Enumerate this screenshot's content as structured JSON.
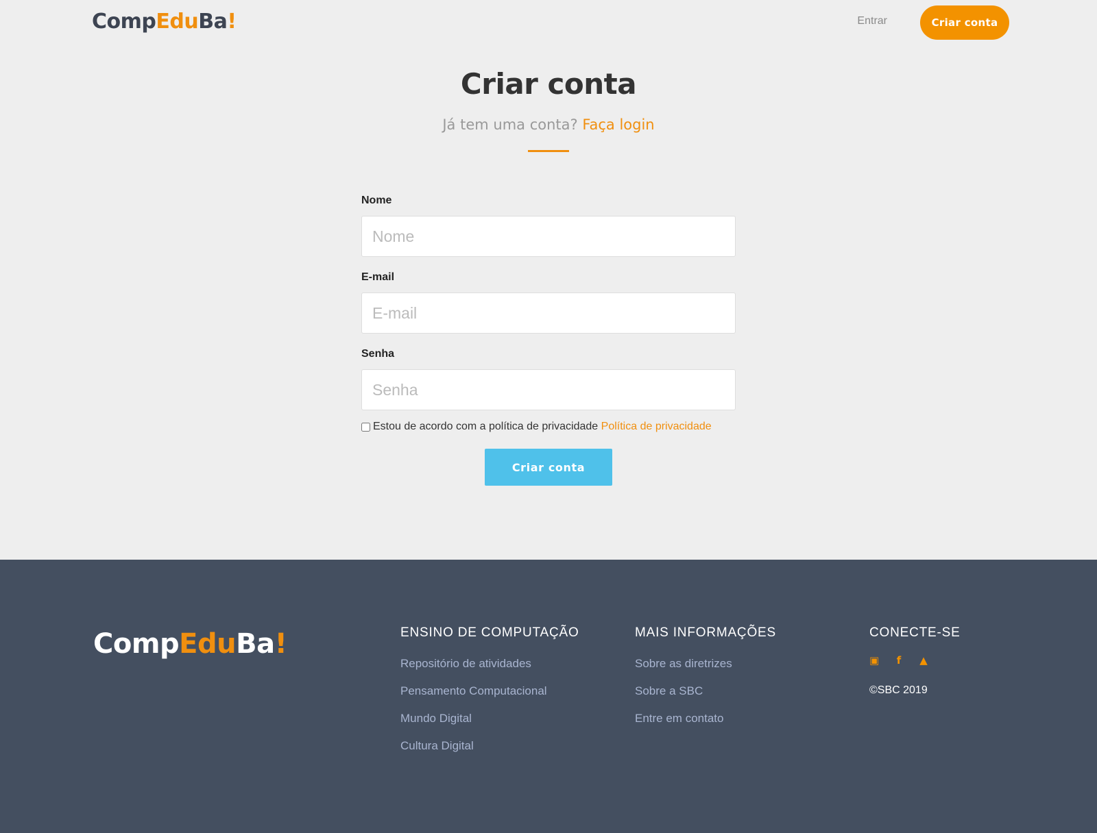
{
  "header": {
    "logo": {
      "part1": "Comp",
      "part2": "Edu",
      "part3": "Ba",
      "part4": "!"
    },
    "login_label": "Entrar",
    "signup_label": "Criar conta"
  },
  "main": {
    "title": "Criar conta",
    "subtitle_text": "Já tem uma conta?",
    "subtitle_link": "Faça login",
    "form": {
      "name_label": "Nome",
      "name_placeholder": "Nome",
      "email_label": "E-mail",
      "email_placeholder": "E-mail",
      "password_label": "Senha",
      "password_placeholder": "Senha",
      "privacy_text": "Estou de acordo com a política de privacidade",
      "privacy_link": "Política de privacidade",
      "submit_label": "Criar conta"
    }
  },
  "footer": {
    "logo": {
      "part1": "Comp",
      "part2": "Edu",
      "part3": "Ba",
      "part4": "!"
    },
    "col1": {
      "heading": "ENSINO DE COMPUTAÇÃO",
      "links": [
        "Repositório de atividades",
        "Pensamento Computacional",
        "Mundo Digital",
        "Cultura Digital"
      ]
    },
    "col2": {
      "heading": "MAIS INFORMAÇÕES",
      "links": [
        "Sobre as diretrizes",
        "Sobre a SBC",
        "Entre em contato"
      ]
    },
    "col3": {
      "heading": "CONECTE-SE",
      "social_icons": [
        "youtube-icon",
        "facebook-icon",
        "twitter-icon"
      ],
      "copyright": "©SBC 2019"
    }
  },
  "colors": {
    "accent": "#f39200",
    "button_blue": "#4fc1ea",
    "footer_bg": "#444f60"
  }
}
